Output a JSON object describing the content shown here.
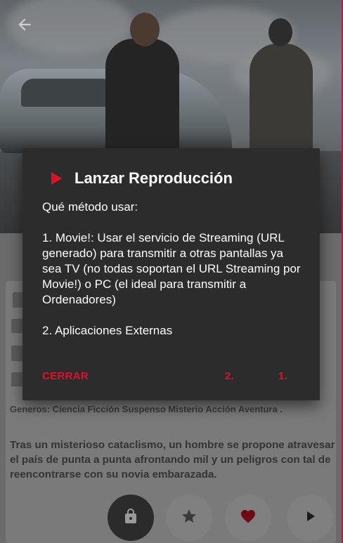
{
  "colors": {
    "accent": "#e0102a",
    "dialog_bg": "#2c2c2c",
    "dialog_text": "#ffffff"
  },
  "icons": {
    "back": "arrow-left-icon",
    "play": "play-triangle-icon",
    "lock": "lock-icon",
    "star": "star-icon",
    "heart": "heart-icon",
    "play_fab": "play-icon"
  },
  "dialog": {
    "title": "Lanzar Reproducción",
    "intro": "Qué método usar:",
    "option1": "1. Movie!: Usar el servicio de Streaming (URL generado) para transmitir a otras pantallas ya sea TV (no todas soportan el URL Streaming por Movie!) o PC (el ideal para transmitir a Ordenadores)",
    "option2": "2. Aplicaciones Externas",
    "buttons": {
      "close": "CERRAR",
      "two": "2.",
      "one": "1."
    }
  },
  "details": {
    "genres": "Generos: Ciencia Ficción Suspenso Misterio Acción Aventura .",
    "synopsis": "Tras un misterioso cataclismo, un hombre se propone atravesar el país de punta a punta afrontando mil y un peligros con tal de reencontrarse con su novia embarazada."
  }
}
